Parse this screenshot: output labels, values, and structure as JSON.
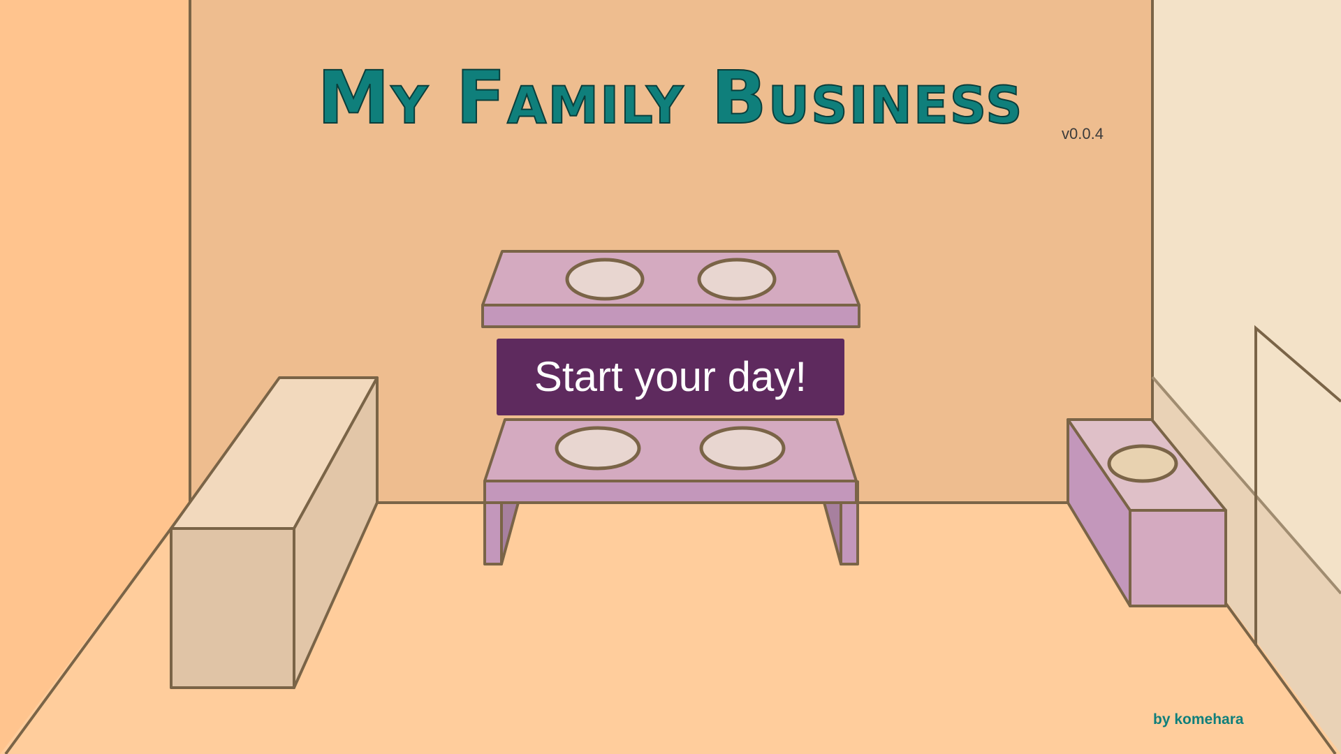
{
  "game": {
    "title": "My Family Business",
    "version": "v0.0.4",
    "credit": "by komehara",
    "start_button_label": "Start your day!"
  },
  "colors": {
    "title": "#0f7f7b",
    "button_bg": "#5e2a5e",
    "wall_back": "#eebd8f",
    "wall_left": "#ffc48e",
    "wall_right": "#f3e2c8",
    "floor": "#ffcd9c",
    "outline": "#7a6447",
    "table_top": "#d4aac0",
    "table_side": "#c397bb",
    "plate": "#e8d6d0",
    "bowl": "#e8d2b0",
    "crate_front": "#e0c4a6",
    "crate_top": "#f2d9bd"
  }
}
